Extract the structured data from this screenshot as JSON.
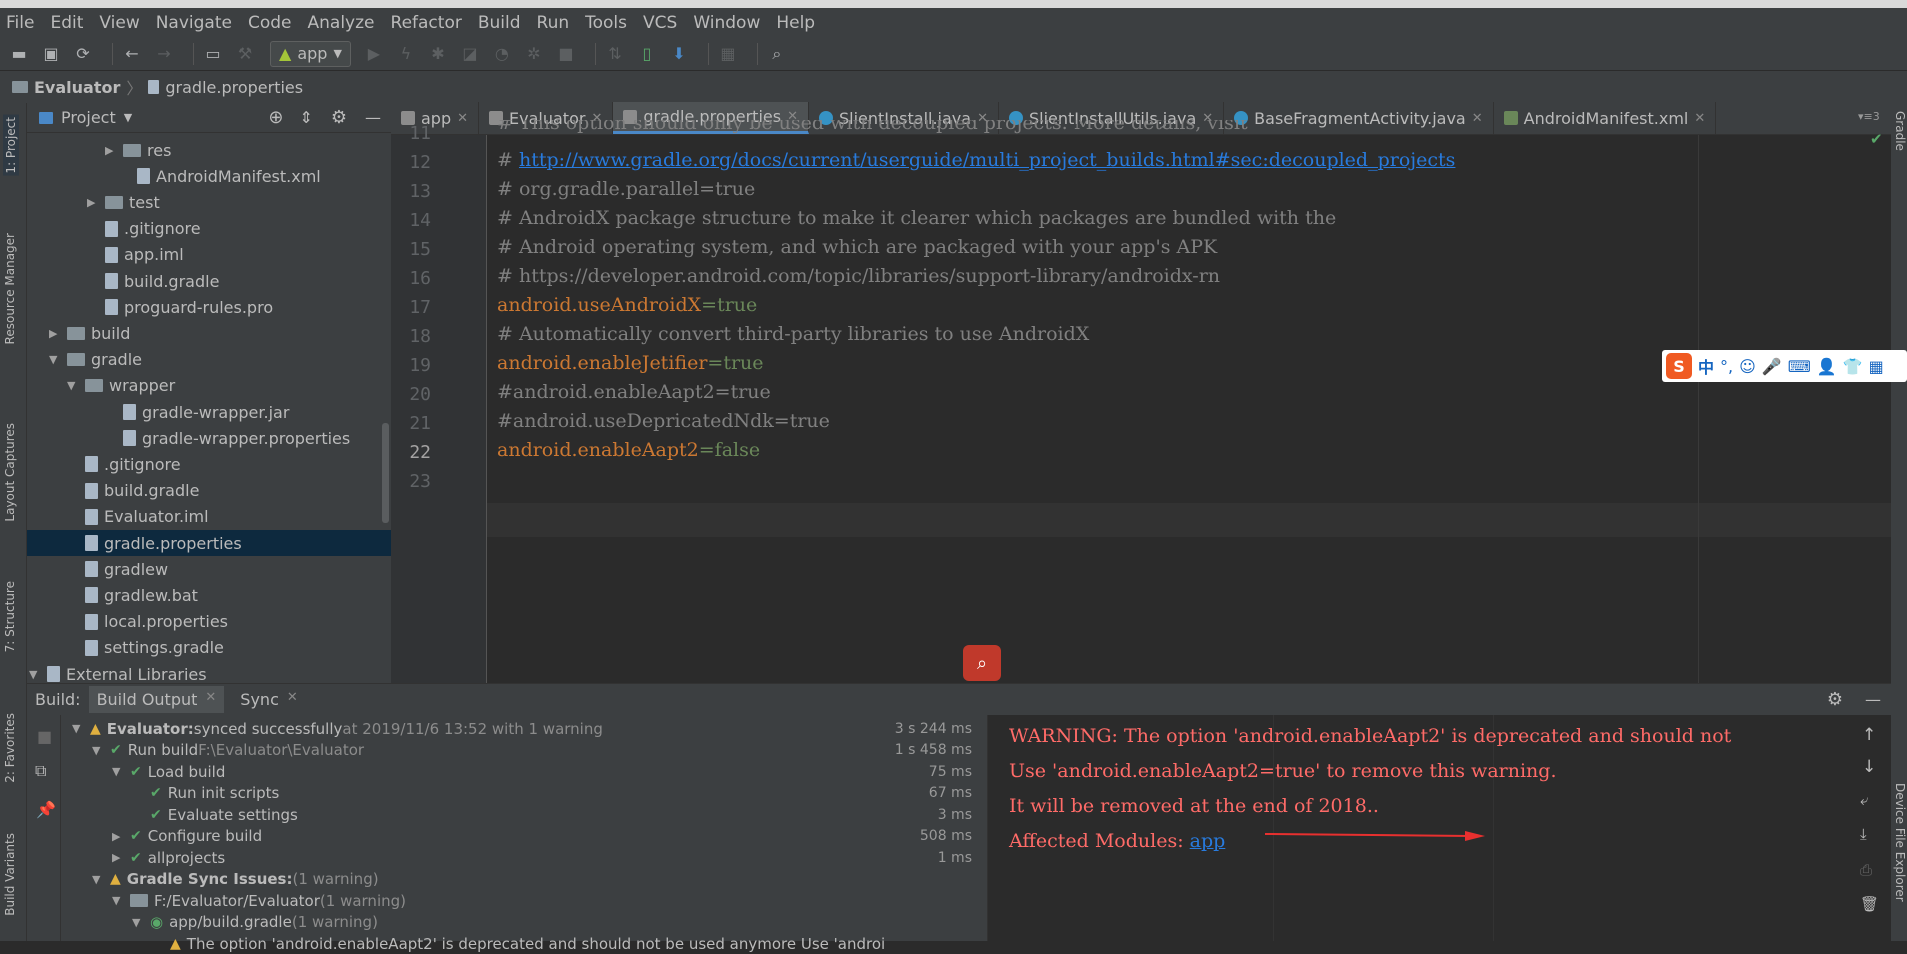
{
  "menu": [
    "File",
    "Edit",
    "View",
    "Navigate",
    "Code",
    "Analyze",
    "Refactor",
    "Build",
    "Run",
    "Tools",
    "VCS",
    "Window",
    "Help"
  ],
  "toolbar": {
    "run_config": "app"
  },
  "breadcrumb": {
    "project": "Evaluator",
    "file": "gradle.properties"
  },
  "left_strip": {
    "project": "1: Project",
    "resource": "Resource Manager",
    "layout": "Layout Captures",
    "structure": "7: Structure",
    "favorites": "2: Favorites",
    "build_variants": "Build Variants"
  },
  "right_strip": {
    "gradle": "Gradle",
    "device": "Device File Explorer"
  },
  "project_panel": {
    "title": "Project",
    "items": [
      {
        "label": "res",
        "type": "folder",
        "arrow": "▶"
      },
      {
        "label": "AndroidManifest.xml",
        "type": "file",
        "arrow": ""
      },
      {
        "label": "test",
        "type": "folder",
        "arrow": "▶"
      },
      {
        "label": ".gitignore",
        "type": "file",
        "arrow": ""
      },
      {
        "label": "app.iml",
        "type": "file",
        "arrow": ""
      },
      {
        "label": "build.gradle",
        "type": "file",
        "arrow": ""
      },
      {
        "label": "proguard-rules.pro",
        "type": "file",
        "arrow": ""
      },
      {
        "label": "build",
        "type": "folder",
        "arrow": "▶"
      },
      {
        "label": "gradle",
        "type": "folder",
        "arrow": "▼"
      },
      {
        "label": "wrapper",
        "type": "folder",
        "arrow": "▼"
      },
      {
        "label": "gradle-wrapper.jar",
        "type": "file",
        "arrow": ""
      },
      {
        "label": "gradle-wrapper.properties",
        "type": "file",
        "arrow": ""
      },
      {
        "label": ".gitignore",
        "type": "file",
        "arrow": ""
      },
      {
        "label": "build.gradle",
        "type": "file",
        "arrow": ""
      },
      {
        "label": "Evaluator.iml",
        "type": "file",
        "arrow": ""
      },
      {
        "label": "gradle.properties",
        "type": "file",
        "arrow": ""
      },
      {
        "label": "gradlew",
        "type": "file",
        "arrow": ""
      },
      {
        "label": "gradlew.bat",
        "type": "file",
        "arrow": ""
      },
      {
        "label": "local.properties",
        "type": "file",
        "arrow": ""
      },
      {
        "label": "settings.gradle",
        "type": "file",
        "arrow": ""
      },
      {
        "label": "External Libraries",
        "type": "lib",
        "arrow": "▼"
      }
    ]
  },
  "tabs": [
    "app",
    "Evaluator",
    "gradle.properties",
    "SlientInstall.java",
    "SlientInstallUtils.java",
    "BaseFragmentActivity.java",
    "AndroidManifest.xml"
  ],
  "editor": {
    "lines": [
      {
        "n": "11",
        "text": "# This option should only be used with decoupled projects. More details, visit"
      },
      {
        "n": "12",
        "prefix": "# ",
        "link": "http://www.gradle.org/docs/current/userguide/multi_project_builds.html#sec:decoupled_projects"
      },
      {
        "n": "13",
        "text": "# org.gradle.parallel=true"
      },
      {
        "n": "14",
        "text": "# AndroidX package structure to make it clearer which packages are bundled with the"
      },
      {
        "n": "15",
        "text": "# Android operating system, and which are packaged with your app's APK"
      },
      {
        "n": "16",
        "text": "# https://developer.android.com/topic/libraries/support-library/androidx-rn"
      },
      {
        "n": "17",
        "key_a": "android.",
        "key_b": "useAndroidX",
        "val": "=true"
      },
      {
        "n": "18",
        "text": "# Automatically convert third-party libraries to use AndroidX"
      },
      {
        "n": "19",
        "key_a": "android.",
        "key_b": "enableJetifier",
        "val": "=true"
      },
      {
        "n": "20",
        "text": "#android.enableAapt2=true"
      },
      {
        "n": "21",
        "text": "#android.useDepricatedNdk=true"
      },
      {
        "n": "22",
        "key_a": "android.",
        "key_b": "enableAapt2",
        "val": "=false"
      },
      {
        "n": "23",
        "text": ""
      }
    ]
  },
  "build": {
    "label": "Build:",
    "tabs": [
      "Build Output",
      "Sync"
    ],
    "rows": [
      {
        "indent": 0,
        "icon": "warn",
        "bold": "Evaluator:",
        "text": " synced successfully",
        "gray": " at 2019/11/6 13:52  with 1 warning",
        "time": "3 s 244 ms",
        "arrow": "▼"
      },
      {
        "indent": 1,
        "icon": "chk",
        "text": "Run build",
        "gray": " F:\\Evaluator\\Evaluator",
        "time": "1 s 458 ms",
        "arrow": "▼"
      },
      {
        "indent": 2,
        "icon": "chk",
        "text": "Load build",
        "gray": "",
        "time": "75 ms",
        "arrow": "▼"
      },
      {
        "indent": 3,
        "icon": "chk",
        "text": "Run init scripts",
        "gray": "",
        "time": "67 ms",
        "arrow": ""
      },
      {
        "indent": 3,
        "icon": "chk",
        "text": "Evaluate settings",
        "gray": "",
        "time": "3 ms",
        "arrow": ""
      },
      {
        "indent": 2,
        "icon": "chk",
        "text": "Configure build",
        "gray": "",
        "time": "508 ms",
        "arrow": "▶"
      },
      {
        "indent": 2,
        "icon": "chk",
        "text": "allprojects",
        "gray": "",
        "time": "1 ms",
        "arrow": "▶"
      },
      {
        "indent": 1,
        "icon": "warn",
        "bold": "Gradle Sync Issues:",
        "text": "",
        "gray": "  (1 warning)",
        "time": "",
        "arrow": "▼"
      },
      {
        "indent": 2,
        "icon": "folder",
        "text": "F:/Evaluator/Evaluator",
        "gray": "  (1 warning)",
        "time": "",
        "arrow": "▼"
      },
      {
        "indent": 3,
        "icon": "gradle",
        "text": "app/build.gradle",
        "gray": "  (1 warning)",
        "time": "",
        "arrow": "▼"
      },
      {
        "indent": 4,
        "icon": "warn",
        "text": "The option 'android.enableAapt2' is deprecated and should not be used anymore Use 'androi",
        "gray": "",
        "time": "",
        "arrow": ""
      }
    ],
    "output": {
      "line1": "WARNING: The option 'android.enableAapt2' is deprecated and should not",
      "line2": "Use 'android.enableAapt2=true' to remove this warning.",
      "line3": "It will be removed at the end of 2018..",
      "line4_prefix": "Affected Modules: ",
      "line4_link": "app"
    }
  },
  "ime": {
    "lang": "中"
  }
}
